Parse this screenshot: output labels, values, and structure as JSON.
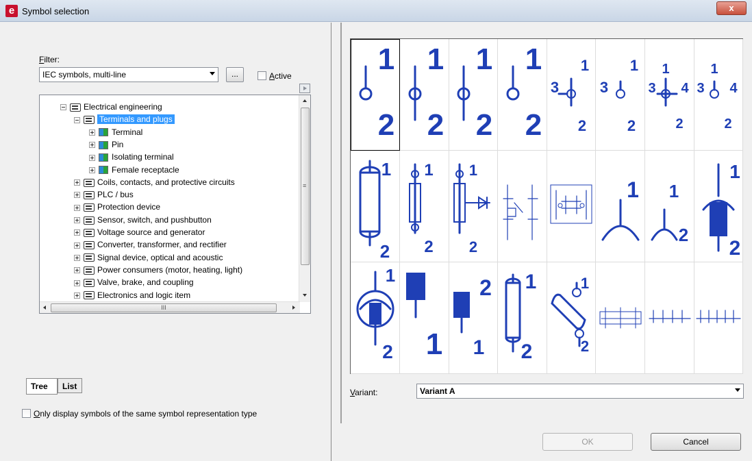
{
  "window": {
    "title": "Symbol selection",
    "app_icon_letter": "e",
    "close_label": "x"
  },
  "filter": {
    "label_prefix": "",
    "label_accel": "F",
    "label_rest": "ilter:",
    "value": "IEC symbols, multi-line",
    "browse_label": "...",
    "active_accel": "A",
    "active_rest": "ctive",
    "active_checked": false
  },
  "tree": {
    "items": [
      {
        "label": "Electrical engineering",
        "level": 0,
        "expanded": true,
        "icon": "folder-icon",
        "selected": false
      },
      {
        "label": "Terminals and plugs",
        "level": 1,
        "expanded": true,
        "icon": "folder-icon",
        "selected": true
      },
      {
        "label": "Terminal",
        "level": 2,
        "expanded": false,
        "icon": "symbol-icon",
        "selected": false
      },
      {
        "label": "Pin",
        "level": 2,
        "expanded": false,
        "icon": "symbol-icon",
        "selected": false
      },
      {
        "label": "Isolating terminal",
        "level": 2,
        "expanded": false,
        "icon": "symbol-icon",
        "selected": false
      },
      {
        "label": "Female receptacle",
        "level": 2,
        "expanded": false,
        "icon": "symbol-icon",
        "selected": false
      },
      {
        "label": "Coils, contacts, and protective circuits",
        "level": 1,
        "expanded": false,
        "icon": "folder-icon",
        "selected": false
      },
      {
        "label": "PLC / bus",
        "level": 1,
        "expanded": false,
        "icon": "folder-icon",
        "selected": false
      },
      {
        "label": "Protection device",
        "level": 1,
        "expanded": false,
        "icon": "folder-icon",
        "selected": false
      },
      {
        "label": "Sensor, switch, and pushbutton",
        "level": 1,
        "expanded": false,
        "icon": "folder-icon",
        "selected": false
      },
      {
        "label": "Voltage source and generator",
        "level": 1,
        "expanded": false,
        "icon": "folder-icon",
        "selected": false
      },
      {
        "label": "Converter, transformer, and rectifier",
        "level": 1,
        "expanded": false,
        "icon": "folder-icon",
        "selected": false
      },
      {
        "label": "Signal device, optical and acoustic",
        "level": 1,
        "expanded": false,
        "icon": "folder-icon",
        "selected": false
      },
      {
        "label": "Power consumers (motor, heating, light)",
        "level": 1,
        "expanded": false,
        "icon": "folder-icon",
        "selected": false
      },
      {
        "label": "Valve, brake, and coupling",
        "level": 1,
        "expanded": false,
        "icon": "folder-icon",
        "selected": false
      },
      {
        "label": "Electronics and logic item",
        "level": 1,
        "expanded": false,
        "icon": "folder-icon",
        "selected": false
      }
    ],
    "hscroll_grip": "III",
    "vscroll_grip": "≡"
  },
  "tabs": [
    {
      "label": "Tree",
      "active": true
    },
    {
      "label": "List",
      "active": false
    }
  ],
  "only_display": {
    "accel": "O",
    "rest": "nly display symbols of the same symbol representation type",
    "checked": false
  },
  "symbols": {
    "cells": [
      {
        "name": "terminal-circle-1-2",
        "labels": [
          "1",
          "2"
        ],
        "selected": true
      },
      {
        "name": "terminal-circle-variant-b",
        "labels": [
          "1",
          "2"
        ]
      },
      {
        "name": "terminal-circle-variant-c",
        "labels": [
          "1",
          "2"
        ]
      },
      {
        "name": "terminal-circle-variant-d",
        "labels": [
          "1",
          "2"
        ]
      },
      {
        "name": "terminal-3-pin",
        "labels": [
          "1",
          "3",
          "2"
        ]
      },
      {
        "name": "terminal-3-pin-open",
        "labels": [
          "1",
          "3",
          "2"
        ]
      },
      {
        "name": "terminal-4-pin",
        "labels": [
          "1",
          "3",
          "4",
          "2"
        ]
      },
      {
        "name": "terminal-4-pin-open",
        "labels": [
          "1",
          "3",
          "4",
          "2"
        ]
      },
      {
        "name": "isolating-terminal-cylinder",
        "labels": [
          "1",
          "2"
        ]
      },
      {
        "name": "fuse-terminal",
        "labels": [
          "1",
          "2"
        ]
      },
      {
        "name": "led-terminal",
        "labels": [
          "1",
          "2"
        ]
      },
      {
        "name": "relay-terminal",
        "labels": []
      },
      {
        "name": "multi-terminal-block",
        "labels": []
      },
      {
        "name": "socket-1",
        "labels": [
          "1"
        ]
      },
      {
        "name": "socket-1-2",
        "labels": [
          "1",
          "2"
        ]
      },
      {
        "name": "plug-1-2",
        "labels": [
          "1",
          "2"
        ]
      },
      {
        "name": "shielded-plug",
        "labels": [
          "1",
          "2"
        ]
      },
      {
        "name": "female-block-1",
        "labels": [
          "1"
        ]
      },
      {
        "name": "female-block-2-1",
        "labels": [
          "2",
          "1"
        ]
      },
      {
        "name": "cylinder-terminal",
        "labels": [
          "1",
          "2"
        ]
      },
      {
        "name": "diagonal-terminal",
        "labels": [
          "1",
          "2"
        ]
      },
      {
        "name": "terminal-strip-dashed",
        "labels": []
      },
      {
        "name": "terminal-strip-4",
        "labels": []
      },
      {
        "name": "terminal-strip-5",
        "labels": []
      }
    ]
  },
  "variant": {
    "label_accel": "V",
    "label_rest": "ariant:",
    "value": "Variant A"
  },
  "buttons": {
    "ok": "OK",
    "cancel": "Cancel"
  },
  "colors": {
    "symbol_blue": "#1f3fb5",
    "selection_blue": "#3399ff"
  }
}
